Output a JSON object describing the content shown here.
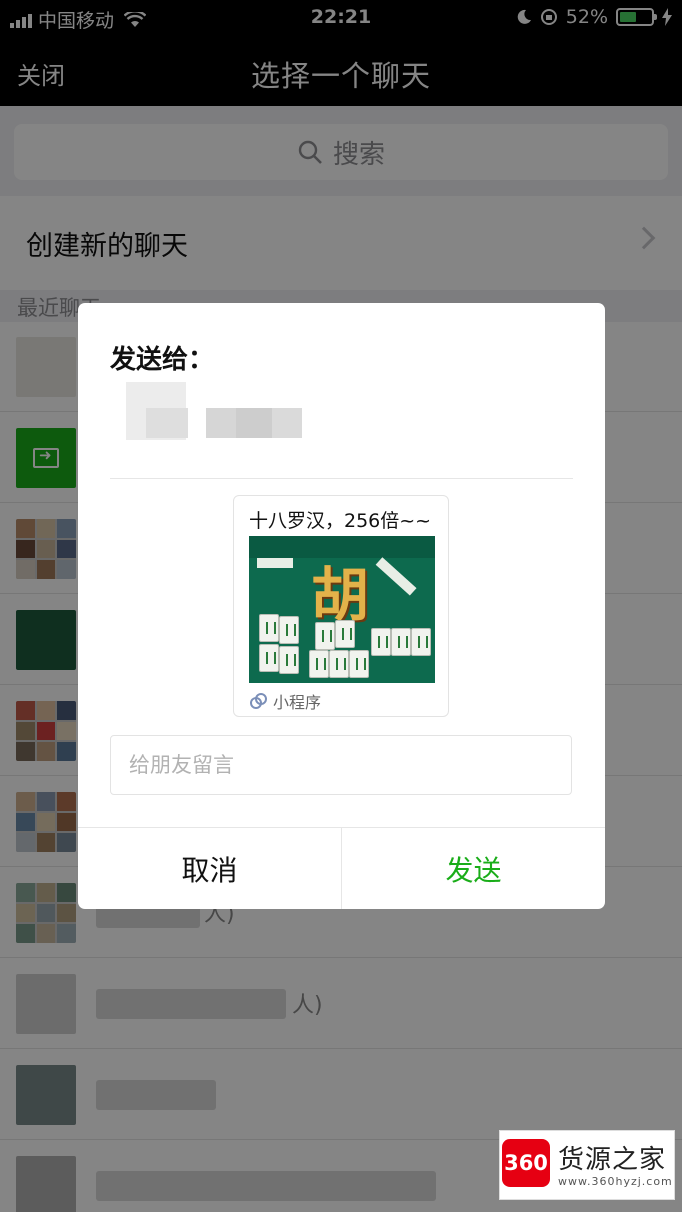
{
  "status_bar": {
    "carrier": "中国移动",
    "time": "22:21",
    "battery": "52%",
    "battery_level": 0.52
  },
  "nav_bar": {
    "close_label": "关闭",
    "title": "选择一个聊天"
  },
  "search": {
    "placeholder": "搜索"
  },
  "new_chat": {
    "label": "创建新的聊天"
  },
  "recent": {
    "label": "最近聊天"
  },
  "chat_list": {
    "row_tails": [
      "人)",
      "人)"
    ]
  },
  "dialog": {
    "send_to_label": "发送给：",
    "card": {
      "title": "十八罗汉，256倍~~",
      "thumb_char": "胡",
      "type_label": "小程序"
    },
    "message": {
      "placeholder": "给朋友留言",
      "value": ""
    },
    "cancel_label": "取消",
    "send_label": "发送"
  },
  "watermark": {
    "logo": "360",
    "name": "货源之家",
    "url": "www.360hyzj.com"
  },
  "colors": {
    "accent_green": "#1aad19",
    "nav_bg": "#000000",
    "watermark_red": "#e60012"
  },
  "icons": [
    "signal-icon",
    "wifi-icon",
    "moon-icon",
    "orientation-lock-icon",
    "battery-icon",
    "charging-icon",
    "search-icon",
    "chevron-right-icon",
    "file-transfer-icon",
    "mini-program-icon"
  ]
}
